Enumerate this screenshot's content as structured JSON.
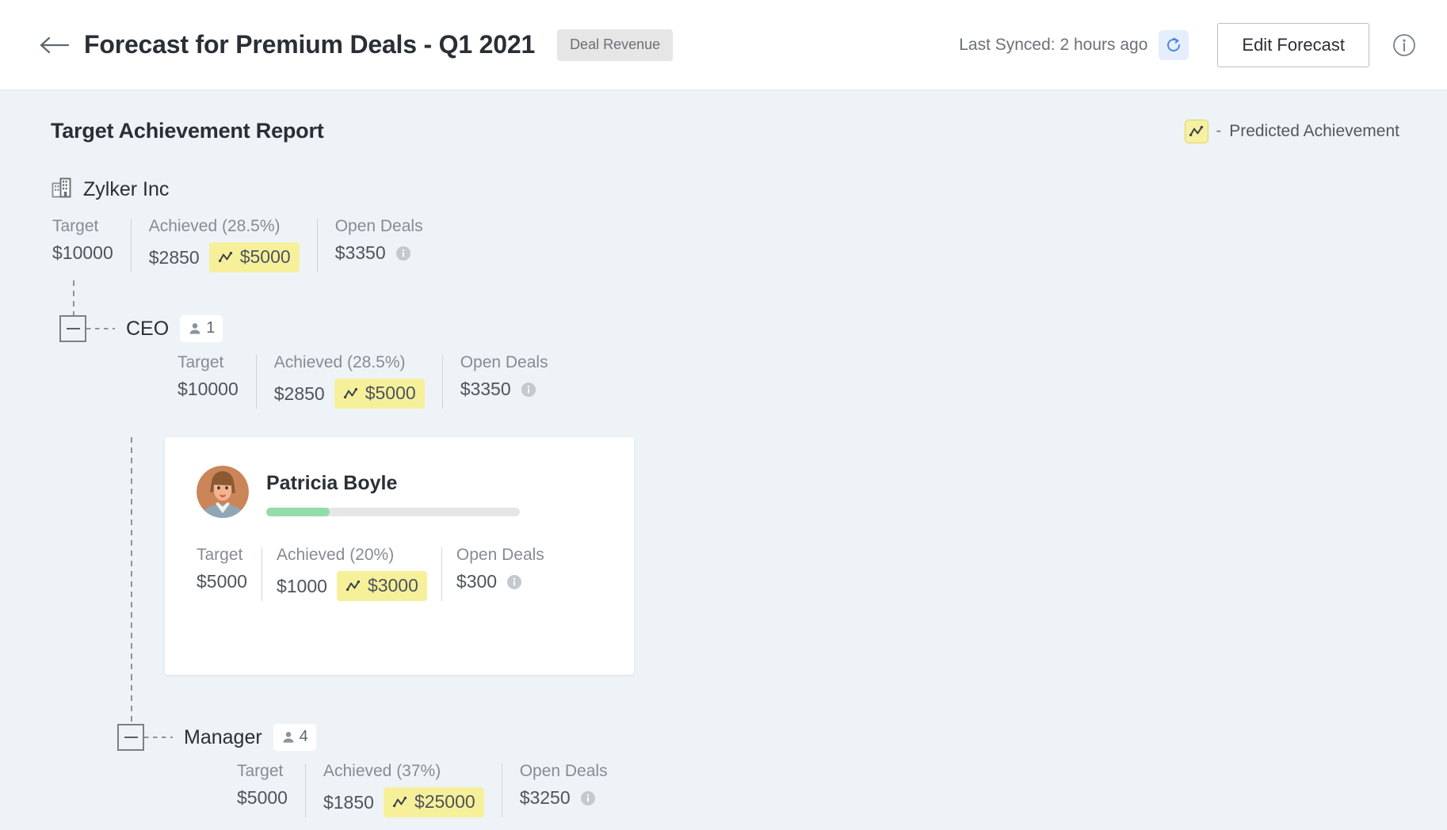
{
  "header": {
    "back_icon": "back-arrow-icon",
    "title": "Forecast for Premium Deals - Q1 2021",
    "module_chip": "Deal Revenue",
    "sync_text": "Last Synced: 2 hours ago",
    "sync_icon": "refresh-icon",
    "edit_button": "Edit Forecast",
    "info_icon": "info-circle-icon",
    "accent_blue": "#4a86d8",
    "sync_bg": "#e4eefc"
  },
  "report": {
    "title": "Target Achievement Report",
    "legend": {
      "icon": "trending-line-icon",
      "dash": "-",
      "label": "Predicted Achievement",
      "chip_bg": "#f6f0a2"
    }
  },
  "organization": {
    "icon": "building-icon",
    "name": "Zylker Inc",
    "stats": {
      "target_label": "Target",
      "target_value": "$10000",
      "achieved_label": "Achieved (28.5%)",
      "achieved_value": "$2850",
      "predicted_value": "$5000",
      "open_label": "Open Deals",
      "open_value": "$3350",
      "info_icon": "info-circle-icon"
    }
  },
  "nodes": [
    {
      "collapse_icon": "minus-box-icon",
      "title": "CEO",
      "count_icon": "person-icon",
      "count": "1",
      "stats": {
        "target_label": "Target",
        "target_value": "$10000",
        "achieved_label": "Achieved (28.5%)",
        "achieved_value": "$2850",
        "predicted_value": "$5000",
        "open_label": "Open Deals",
        "open_value": "$3350",
        "info_icon": "info-circle-icon"
      }
    },
    {
      "collapse_icon": "minus-box-icon",
      "title": "Manager",
      "count_icon": "person-icon",
      "count": "4",
      "stats": {
        "target_label": "Target",
        "target_value": "$5000",
        "achieved_label": "Achieved (37%)",
        "achieved_value": "$1850",
        "predicted_value": "$25000",
        "open_label": "Open Deals",
        "open_value": "$3250",
        "info_icon": "info-circle-icon"
      }
    }
  ],
  "member_card": {
    "avatar_icon": "user-avatar",
    "name": "Patricia Boyle",
    "progress_percent": 25,
    "progress_color": "#92dcaa",
    "stats": {
      "target_label": "Target",
      "target_value": "$5000",
      "achieved_label": "Achieved (20%)",
      "achieved_value": "$1000",
      "predicted_value": "$3000",
      "open_label": "Open Deals",
      "open_value": "$300",
      "info_icon": "info-circle-icon"
    }
  }
}
